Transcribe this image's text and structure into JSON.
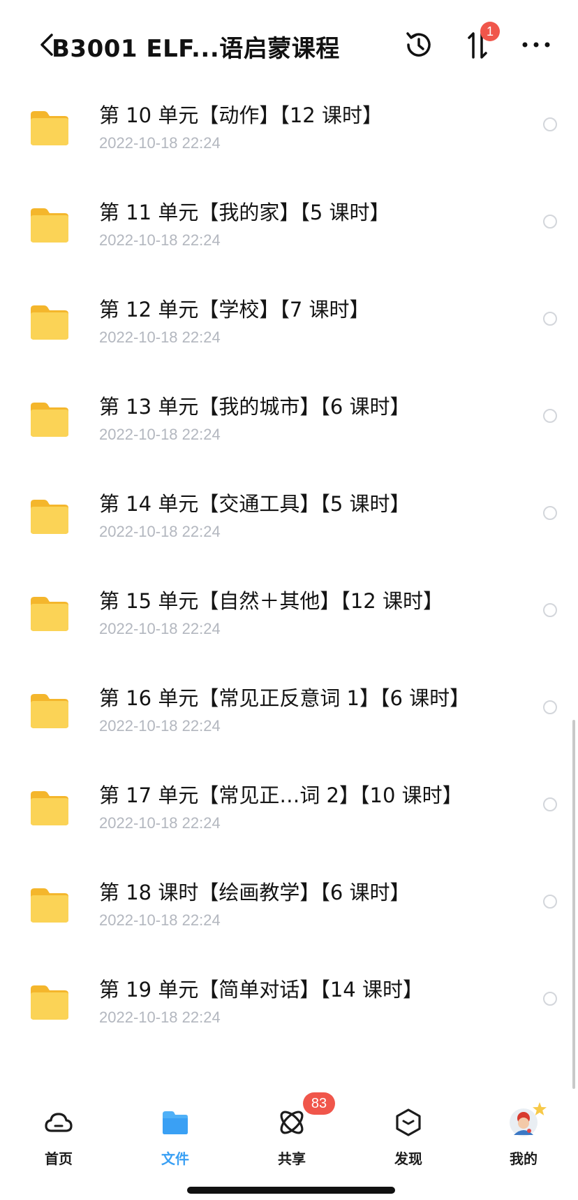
{
  "header": {
    "title": "B3001 ELF...语启蒙课程",
    "transfer_badge": "1"
  },
  "folders": [
    {
      "name": "第 10 单元【动作】【12 课时】",
      "date": "2022-10-18 22:24"
    },
    {
      "name": "第 11 单元【我的家】【5 课时】",
      "date": "2022-10-18 22:24"
    },
    {
      "name": "第 12 单元【学校】【7 课时】",
      "date": "2022-10-18 22:24"
    },
    {
      "name": "第 13 单元【我的城市】【6 课时】",
      "date": "2022-10-18 22:24"
    },
    {
      "name": "第 14 单元【交通工具】【5 课时】",
      "date": "2022-10-18 22:24"
    },
    {
      "name": "第 15 单元【自然＋其他】【12 课时】",
      "date": "2022-10-18 22:24"
    },
    {
      "name": "第 16 单元【常见正反意词 1】【6 课时】",
      "date": "2022-10-18 22:24"
    },
    {
      "name": "第 17 单元【常见正…词 2】【10 课时】",
      "date": "2022-10-18 22:24"
    },
    {
      "name": "第 18 课时【绘画教学】【6 课时】",
      "date": "2022-10-18 22:24"
    },
    {
      "name": "第 19 单元【简单对话】【14 课时】",
      "date": "2022-10-18 22:24"
    }
  ],
  "tabbar": {
    "home": "首页",
    "files": "文件",
    "share": "共享",
    "share_badge": "83",
    "discover": "发现",
    "me": "我的"
  },
  "colors": {
    "accent": "#3aa0f4",
    "badge": "#f0564b",
    "folder": "#f9cb45",
    "date_text": "#b3b7bf"
  }
}
